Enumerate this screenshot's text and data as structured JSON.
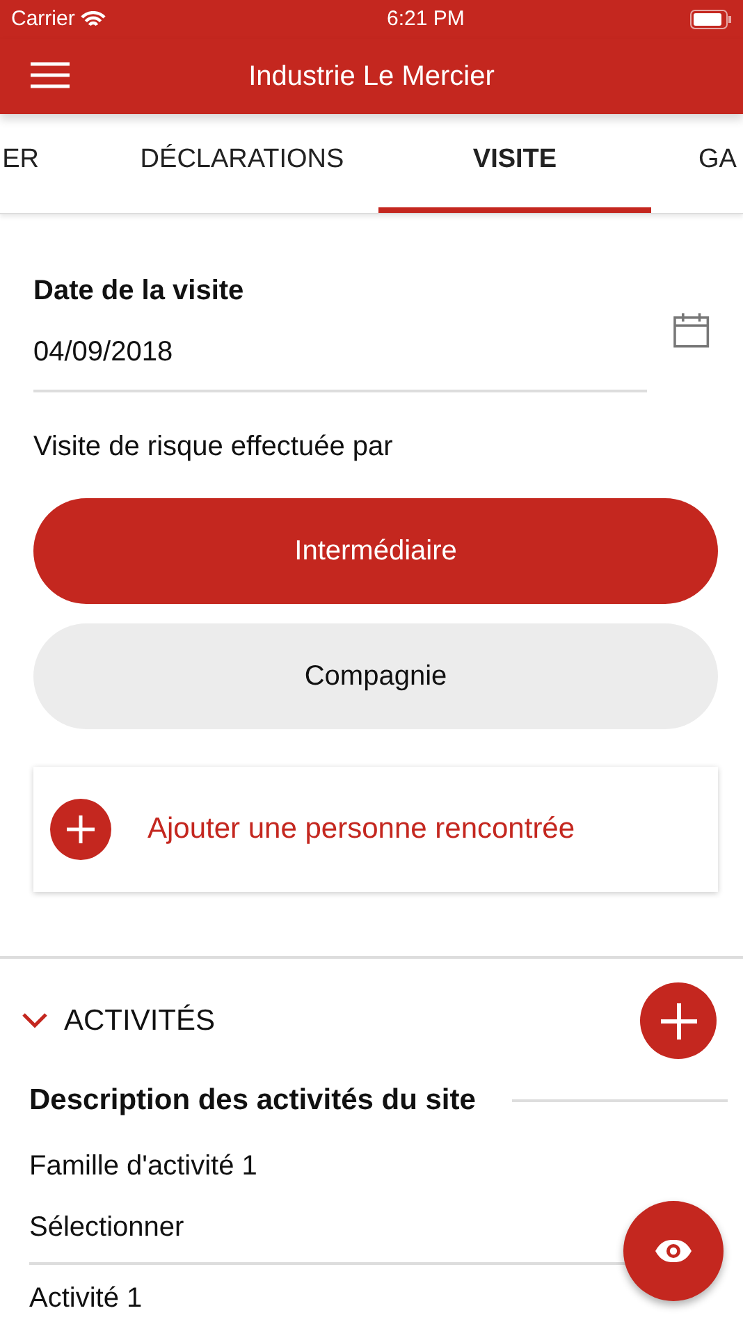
{
  "status_bar": {
    "carrier": "Carrier",
    "time": "6:21 PM"
  },
  "header": {
    "title": "Industrie Le Mercier"
  },
  "tabs": [
    {
      "label": "ER",
      "selected": false
    },
    {
      "label": "DÉCLARATIONS",
      "selected": false
    },
    {
      "label": "VISITE",
      "selected": true
    },
    {
      "label": "GA",
      "selected": false
    }
  ],
  "visit": {
    "date_label": "Date de la visite",
    "date_value": "04/09/2018",
    "performed_by_label": "Visite de risque effectuée par",
    "options": [
      {
        "label": "Intermédiaire",
        "selected": true
      },
      {
        "label": "Compagnie",
        "selected": false
      }
    ],
    "add_person": "Ajouter une personne rencontrée"
  },
  "activities": {
    "title": "ACTIVITÉS",
    "expanded": true,
    "subtitle": "Description des activités du site",
    "family_label": "Famille d'activité 1",
    "family_value": "Sélectionner",
    "activity_label": "Activité 1"
  }
}
